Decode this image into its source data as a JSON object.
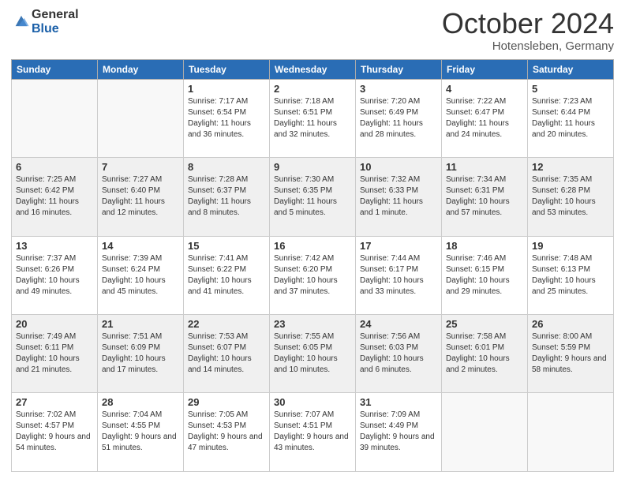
{
  "header": {
    "logo_general": "General",
    "logo_blue": "Blue",
    "month_title": "October 2024",
    "location": "Hotensleben, Germany"
  },
  "weekdays": [
    "Sunday",
    "Monday",
    "Tuesday",
    "Wednesday",
    "Thursday",
    "Friday",
    "Saturday"
  ],
  "weeks": [
    [
      {
        "day": "",
        "info": ""
      },
      {
        "day": "",
        "info": ""
      },
      {
        "day": "1",
        "info": "Sunrise: 7:17 AM\nSunset: 6:54 PM\nDaylight: 11 hours and 36 minutes."
      },
      {
        "day": "2",
        "info": "Sunrise: 7:18 AM\nSunset: 6:51 PM\nDaylight: 11 hours and 32 minutes."
      },
      {
        "day": "3",
        "info": "Sunrise: 7:20 AM\nSunset: 6:49 PM\nDaylight: 11 hours and 28 minutes."
      },
      {
        "day": "4",
        "info": "Sunrise: 7:22 AM\nSunset: 6:47 PM\nDaylight: 11 hours and 24 minutes."
      },
      {
        "day": "5",
        "info": "Sunrise: 7:23 AM\nSunset: 6:44 PM\nDaylight: 11 hours and 20 minutes."
      }
    ],
    [
      {
        "day": "6",
        "info": "Sunrise: 7:25 AM\nSunset: 6:42 PM\nDaylight: 11 hours and 16 minutes."
      },
      {
        "day": "7",
        "info": "Sunrise: 7:27 AM\nSunset: 6:40 PM\nDaylight: 11 hours and 12 minutes."
      },
      {
        "day": "8",
        "info": "Sunrise: 7:28 AM\nSunset: 6:37 PM\nDaylight: 11 hours and 8 minutes."
      },
      {
        "day": "9",
        "info": "Sunrise: 7:30 AM\nSunset: 6:35 PM\nDaylight: 11 hours and 5 minutes."
      },
      {
        "day": "10",
        "info": "Sunrise: 7:32 AM\nSunset: 6:33 PM\nDaylight: 11 hours and 1 minute."
      },
      {
        "day": "11",
        "info": "Sunrise: 7:34 AM\nSunset: 6:31 PM\nDaylight: 10 hours and 57 minutes."
      },
      {
        "day": "12",
        "info": "Sunrise: 7:35 AM\nSunset: 6:28 PM\nDaylight: 10 hours and 53 minutes."
      }
    ],
    [
      {
        "day": "13",
        "info": "Sunrise: 7:37 AM\nSunset: 6:26 PM\nDaylight: 10 hours and 49 minutes."
      },
      {
        "day": "14",
        "info": "Sunrise: 7:39 AM\nSunset: 6:24 PM\nDaylight: 10 hours and 45 minutes."
      },
      {
        "day": "15",
        "info": "Sunrise: 7:41 AM\nSunset: 6:22 PM\nDaylight: 10 hours and 41 minutes."
      },
      {
        "day": "16",
        "info": "Sunrise: 7:42 AM\nSunset: 6:20 PM\nDaylight: 10 hours and 37 minutes."
      },
      {
        "day": "17",
        "info": "Sunrise: 7:44 AM\nSunset: 6:17 PM\nDaylight: 10 hours and 33 minutes."
      },
      {
        "day": "18",
        "info": "Sunrise: 7:46 AM\nSunset: 6:15 PM\nDaylight: 10 hours and 29 minutes."
      },
      {
        "day": "19",
        "info": "Sunrise: 7:48 AM\nSunset: 6:13 PM\nDaylight: 10 hours and 25 minutes."
      }
    ],
    [
      {
        "day": "20",
        "info": "Sunrise: 7:49 AM\nSunset: 6:11 PM\nDaylight: 10 hours and 21 minutes."
      },
      {
        "day": "21",
        "info": "Sunrise: 7:51 AM\nSunset: 6:09 PM\nDaylight: 10 hours and 17 minutes."
      },
      {
        "day": "22",
        "info": "Sunrise: 7:53 AM\nSunset: 6:07 PM\nDaylight: 10 hours and 14 minutes."
      },
      {
        "day": "23",
        "info": "Sunrise: 7:55 AM\nSunset: 6:05 PM\nDaylight: 10 hours and 10 minutes."
      },
      {
        "day": "24",
        "info": "Sunrise: 7:56 AM\nSunset: 6:03 PM\nDaylight: 10 hours and 6 minutes."
      },
      {
        "day": "25",
        "info": "Sunrise: 7:58 AM\nSunset: 6:01 PM\nDaylight: 10 hours and 2 minutes."
      },
      {
        "day": "26",
        "info": "Sunrise: 8:00 AM\nSunset: 5:59 PM\nDaylight: 9 hours and 58 minutes."
      }
    ],
    [
      {
        "day": "27",
        "info": "Sunrise: 7:02 AM\nSunset: 4:57 PM\nDaylight: 9 hours and 54 minutes."
      },
      {
        "day": "28",
        "info": "Sunrise: 7:04 AM\nSunset: 4:55 PM\nDaylight: 9 hours and 51 minutes."
      },
      {
        "day": "29",
        "info": "Sunrise: 7:05 AM\nSunset: 4:53 PM\nDaylight: 9 hours and 47 minutes."
      },
      {
        "day": "30",
        "info": "Sunrise: 7:07 AM\nSunset: 4:51 PM\nDaylight: 9 hours and 43 minutes."
      },
      {
        "day": "31",
        "info": "Sunrise: 7:09 AM\nSunset: 4:49 PM\nDaylight: 9 hours and 39 minutes."
      },
      {
        "day": "",
        "info": ""
      },
      {
        "day": "",
        "info": ""
      }
    ]
  ]
}
